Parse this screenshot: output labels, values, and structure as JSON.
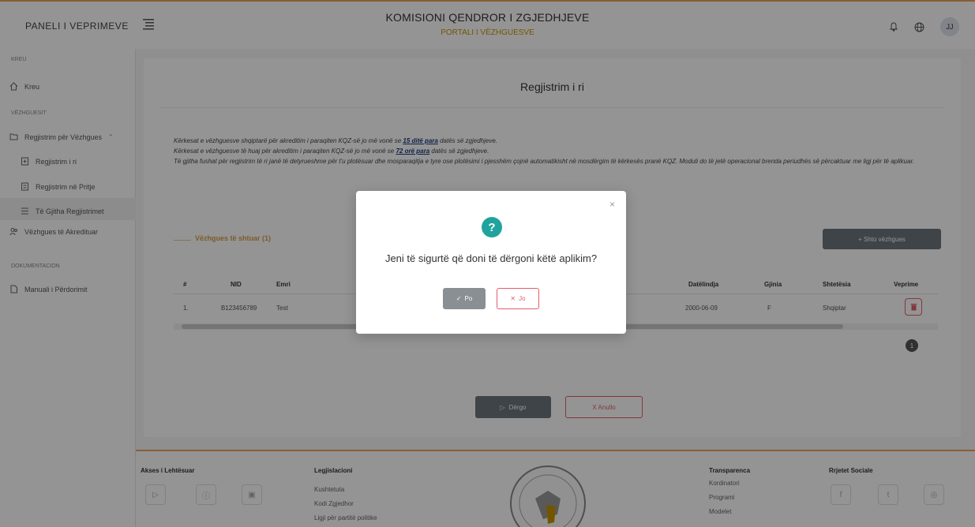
{
  "header": {
    "brand": "PANELI I VEPRIMEVE",
    "title": "KOMISIONI QENDROR I ZGJEDHJEVE",
    "subtitle": "PORTALI I VËZHGUESVE",
    "avatar_initials": "JJ"
  },
  "sidebar": {
    "section_kreu": "KREU",
    "kreu": "Kreu",
    "section_vezhguesit": "VËZHGUESIT",
    "regjistrim_group": "Regjistrim për Vëzhgues",
    "regjistrim_i_ri": "Regjistrim i ri",
    "regjistrim_ne_pritje": "Regjistrim në Pritje",
    "te_gjitha": "Të Gjitha Regjistrimet",
    "vezhgues_akredituar": "Vëzhgues të Akredituar",
    "section_dokumentacion": "DOKUMENTACION",
    "manuali": "Manuali i Përdorimit"
  },
  "page": {
    "title": "Regjistrim i ri",
    "notice_line1_pre": "Kërkesat e vëzhguesve shqiptarë për akreditim i paraqiten KQZ-së jo më vonë se ",
    "notice_line1_em": "15 ditë para",
    "notice_line1_post": " datës së zgjedhjeve.",
    "notice_line2_pre": "Kërkesat e vëzhguesve të huaj për akreditim i paraqiten KQZ-së jo më vonë se ",
    "notice_line2_em": "72 orë para",
    "notice_line2_post": " datës së zgjedhjeve.",
    "notice_line3": "Të gjitha fushat për regjistrim të ri janë të detyrueshme për t'u plotësuar dhe mosparaqitja e tyre ose plotësimi i pjesshëm çojnë automatikisht në mosdërgim të kërkesës pranë KQZ. Moduli do të jetë operacional brenda periudhës së përcaktuar me ligj për të aplikuar.",
    "tab_label": "Vëzhgues të shtuar (1)",
    "add_button": "+ Shto vëzhgues",
    "table": {
      "headers": [
        "#",
        "NID",
        "Emri",
        "Datëlindja",
        "Gjinia",
        "Shtetësia",
        "Veprime"
      ],
      "row": [
        "1.",
        "B123456789",
        "Test",
        "2000-06-09",
        "F",
        "Shqiptar"
      ]
    },
    "page_number": "1",
    "send_button": "Dërgo",
    "cancel_button": "X Anullo"
  },
  "footer": {
    "akses_title": "Akses i Lehtësuar",
    "legjislacioni_title": "Legjislacioni",
    "links_legjislacioni": [
      "Kushtetuta",
      "Kodi Zgjedhor",
      "Ligji për partitë politike"
    ],
    "transparenca_title": "Transparenca",
    "links_transparenca": [
      "Kordinatori",
      "Programi",
      "Modelet"
    ],
    "rrjetet_title": "Rrjetet Sociale"
  },
  "modal": {
    "question": "Jeni të sigurtë që doni të dërgoni këtë aplikim?",
    "yes_label": "Po",
    "no_label": "Jo",
    "close_symbol": "×"
  },
  "colors": {
    "accent": "#e8a25a",
    "teal": "#20a39e",
    "danger": "#e35d6a",
    "gray_button": "#6c757d"
  }
}
